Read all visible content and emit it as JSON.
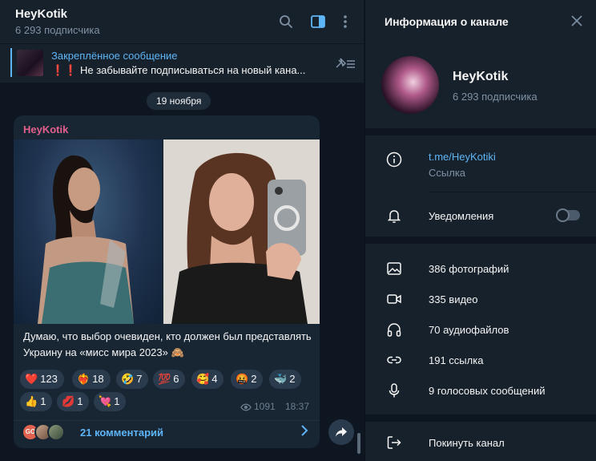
{
  "header": {
    "title": "HeyKotik",
    "subscribers": "6 293 подписчика",
    "icons": [
      "search-icon",
      "sidebar-toggle-icon",
      "more-vert-icon"
    ]
  },
  "pinned": {
    "label": "Закреплённое сообщение",
    "text": "❗❗ Не забывайте подписываться на новый кана..."
  },
  "date_label": "19 ноября",
  "message": {
    "author": "HeyKotik",
    "text": "Думаю, что выбор очевиден, кто должен был представлять Украину на «мисс мира 2023» 🙈",
    "reactions": [
      {
        "emoji": "❤️",
        "count": "123"
      },
      {
        "emoji": "❤️‍🔥",
        "count": "18"
      },
      {
        "emoji": "🤣",
        "count": "7"
      },
      {
        "emoji": "💯",
        "count": "6"
      },
      {
        "emoji": "🥰",
        "count": "4"
      },
      {
        "emoji": "🤬",
        "count": "2"
      },
      {
        "emoji": "🐳",
        "count": "2"
      },
      {
        "emoji": "👍",
        "count": "1"
      },
      {
        "emoji": "💋",
        "count": "1"
      },
      {
        "emoji": "💘",
        "count": "1"
      }
    ],
    "views": "1091",
    "time": "18:37",
    "comments_label": "21 комментарий",
    "avatar_initials": "GO"
  },
  "info_panel": {
    "title": "Информация о канале",
    "channel_name": "HeyKotik",
    "subscribers": "6 293 подписчика",
    "link": "t.me/HeyKotiki",
    "link_caption": "Ссылка",
    "notifications_label": "Уведомления",
    "media": [
      {
        "icon": "photo-icon",
        "label": "386 фотографий"
      },
      {
        "icon": "video-icon",
        "label": "335 видео"
      },
      {
        "icon": "headphones-icon",
        "label": "70 аудиофайлов"
      },
      {
        "icon": "link-icon",
        "label": "191 ссылка"
      },
      {
        "icon": "mic-icon",
        "label": "9 голосовых сообщений"
      }
    ],
    "leave_label": "Покинуть канал"
  },
  "colors": {
    "accent": "#5eb5f7",
    "author": "#e25f8e",
    "panel_bg": "#17212b",
    "chat_bg": "#0e1621",
    "bubble_bg": "#182533"
  }
}
